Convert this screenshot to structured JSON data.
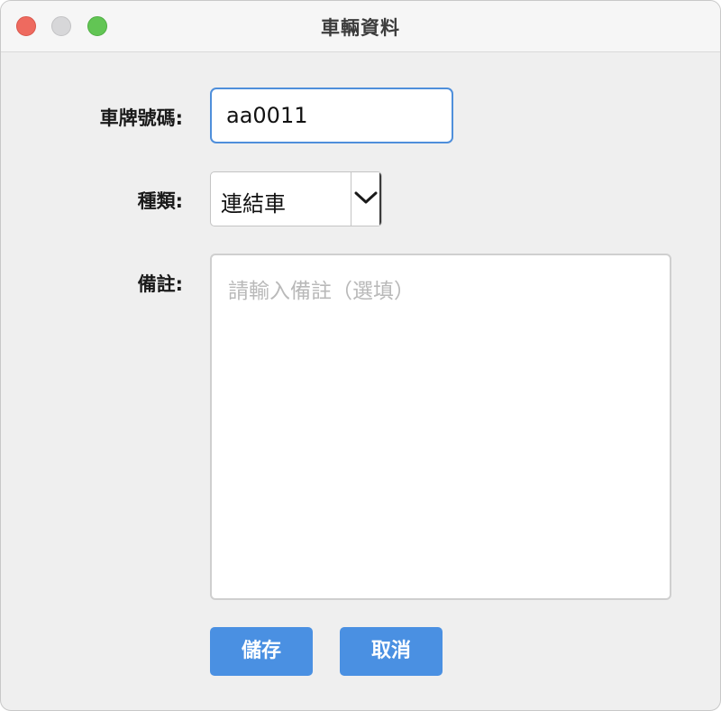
{
  "window": {
    "title": "車輛資料"
  },
  "form": {
    "plate": {
      "label": "車牌號碼:",
      "value": "aa0011"
    },
    "type": {
      "label": "種類:",
      "selected": "連結車"
    },
    "notes": {
      "label": "備註:",
      "placeholder": "請輸入備註（選填）",
      "value": ""
    }
  },
  "buttons": {
    "save_label": "儲存",
    "cancel_label": "取消"
  },
  "colors": {
    "button": "#4a90e2",
    "focus_border": "#4f8fdb",
    "close": "#ee6a5f",
    "minimize": "#d7d7d9",
    "zoom": "#62c554"
  },
  "icons": {
    "select_arrow": "chevron-down-icon"
  }
}
